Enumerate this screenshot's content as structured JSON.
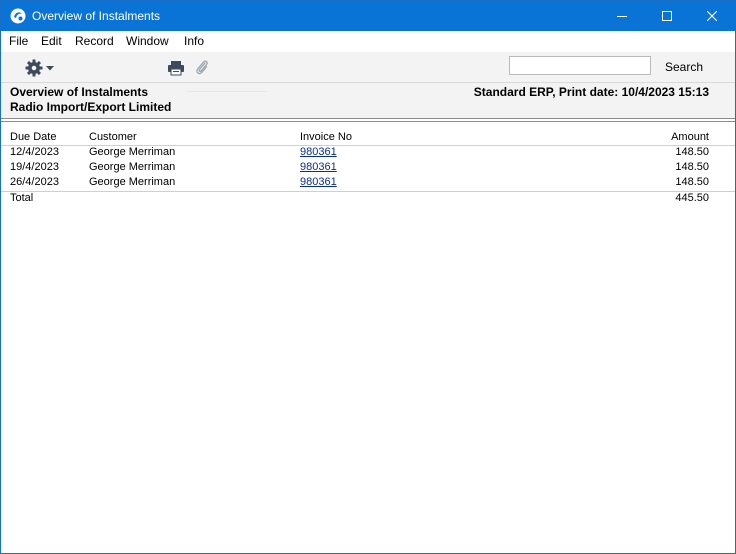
{
  "window": {
    "title": "Overview of Instalments",
    "controls": [
      "minimize-icon",
      "maximize-icon",
      "close-icon"
    ]
  },
  "menu": {
    "items": [
      "File",
      "Edit",
      "Record",
      "Window",
      "Info"
    ]
  },
  "toolbar": {
    "icons": [
      "gear-icon",
      "chevron-down-icon",
      "printer-icon",
      "paperclip-icon"
    ],
    "search_value": "",
    "search_label": "Search"
  },
  "report_header": {
    "title": "Overview of Instalments",
    "company": "Radio Import/Export Limited",
    "print_info": "Standard ERP, Print date:  10/4/2023 15:13"
  },
  "table": {
    "columns": [
      "Due Date",
      "Customer",
      "Invoice No",
      "Amount"
    ],
    "rows": [
      {
        "due_date": "12/4/2023",
        "customer": "George Merriman",
        "invoice_no": "980361",
        "amount": "148.50"
      },
      {
        "due_date": "19/4/2023",
        "customer": "George Merriman",
        "invoice_no": "980361",
        "amount": "148.50"
      },
      {
        "due_date": "26/4/2023",
        "customer": "George Merriman",
        "invoice_no": "980361",
        "amount": "148.50"
      }
    ],
    "total_label": "Total",
    "total_amount": "445.50"
  },
  "colors": {
    "titlebar": "#0a74d6",
    "link": "#0b2f8f",
    "toolbar_bg": "#f3f3f3"
  }
}
